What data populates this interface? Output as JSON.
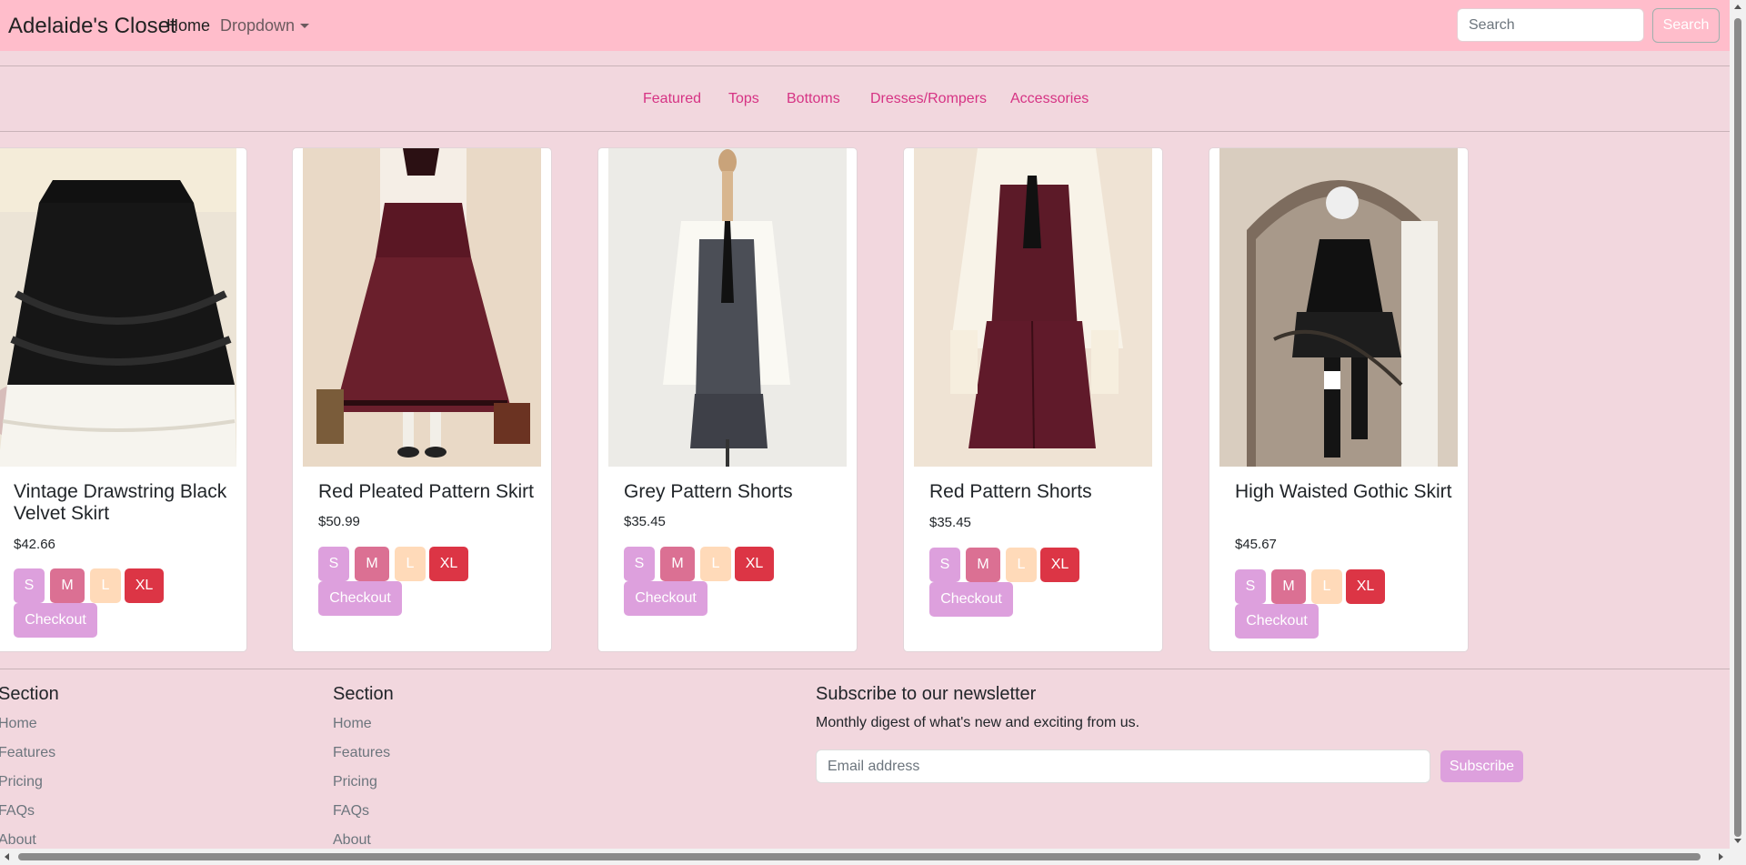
{
  "navbar": {
    "brand": "Adelaide's Closet",
    "links": [
      {
        "label": "Home"
      },
      {
        "label": "Dropdown"
      }
    ],
    "search_placeholder": "Search",
    "search_button": "Search",
    "bg_color": "#ffbdcb"
  },
  "categories": [
    "Featured",
    "Tops",
    "Bottoms",
    "Dresses/Rompers",
    "Accessories"
  ],
  "products": [
    {
      "title": "Vintage Drawstring Black Velvet Skirt",
      "price": "$42.66",
      "sizes": [
        "S",
        "M",
        "L",
        "XL"
      ],
      "checkout": "Checkout"
    },
    {
      "title": "Red Pleated Pattern Skirt",
      "price": "$50.99",
      "sizes": [
        "S",
        "M",
        "L",
        "XL"
      ],
      "checkout": "Checkout"
    },
    {
      "title": "Grey Pattern Shorts",
      "price": "$35.45",
      "sizes": [
        "S",
        "M",
        "L",
        "XL"
      ],
      "checkout": "Checkout"
    },
    {
      "title": "Red Pattern Shorts",
      "price": "$35.45",
      "sizes": [
        "S",
        "M",
        "L",
        "XL"
      ],
      "checkout": "Checkout"
    },
    {
      "title": "High Waisted Gothic Skirt",
      "price": "$45.67",
      "sizes": [
        "S",
        "M",
        "L",
        "XL"
      ],
      "checkout": "Checkout"
    }
  ],
  "size_colors": {
    "S": "#dda0dd",
    "M": "#db7093",
    "L": "#ffdab9",
    "XL": "#dc3545"
  },
  "footer": {
    "sections": [
      {
        "title": "Section",
        "links": [
          "Home",
          "Features",
          "Pricing",
          "FAQs",
          "About"
        ]
      },
      {
        "title": "Section",
        "links": [
          "Home",
          "Features",
          "Pricing",
          "FAQs",
          "About"
        ]
      }
    ],
    "newsletter": {
      "title": "Subscribe to our newsletter",
      "description": "Monthly digest of what's new and exciting from us.",
      "email_placeholder": "Email address",
      "button": "Subscribe"
    }
  }
}
